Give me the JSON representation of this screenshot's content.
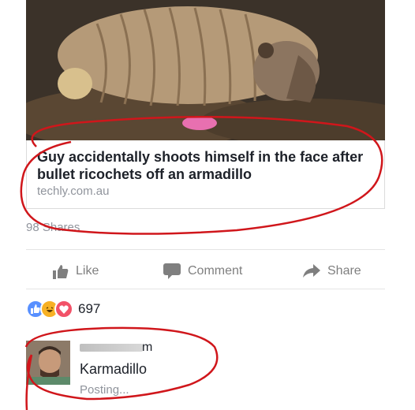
{
  "link_preview": {
    "title": "Guy accidentally shoots himself in the face after bullet ricochets off an armadillo",
    "domain": "techly.com.au"
  },
  "shares_text": "98 Shares",
  "actions": {
    "like": "Like",
    "comment": "Comment",
    "share": "Share"
  },
  "reactions": {
    "types": [
      "like",
      "haha",
      "love"
    ],
    "count": "697"
  },
  "comment": {
    "author_visible_suffix": "m",
    "text": "Karmadillo",
    "status": "Posting..."
  },
  "icons": {
    "like": "thumbs-up-icon",
    "comment": "speech-bubble-icon",
    "share": "share-arrow-icon"
  },
  "colors": {
    "link_text": "#1d2129",
    "muted_text": "#90949c",
    "annotation": "#d0161b",
    "like_reaction": "#5890ff",
    "haha_reaction": "#f7b125",
    "love_reaction": "#f25268"
  }
}
